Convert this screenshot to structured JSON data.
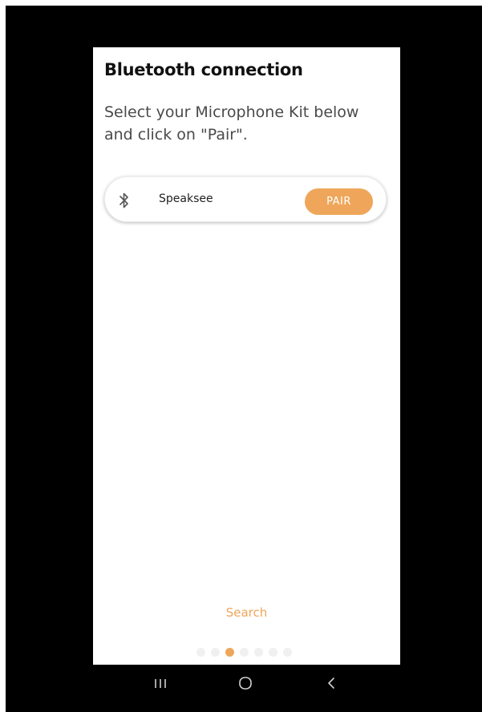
{
  "screen": {
    "title": "Bluetooth connection",
    "subtitle": "Select your Microphone Kit below and click on \"Pair\"."
  },
  "devices": [
    {
      "icon": "bluetooth-icon",
      "name": "Speaksee",
      "action_label": "PAIR"
    }
  ],
  "search_label": "Search",
  "pager": {
    "total": 7,
    "current": 3
  },
  "colors": {
    "accent": "#efa65a",
    "background": "#ffffff",
    "frame": "#000000"
  },
  "system_nav": {
    "icons": [
      "recents-icon",
      "home-icon",
      "back-icon"
    ]
  }
}
